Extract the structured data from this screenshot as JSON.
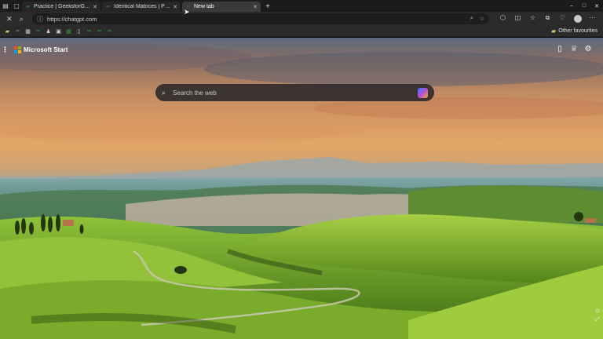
{
  "browser": {
    "tabs": [
      {
        "title": "Practice | GeeksforGee",
        "active": false
      },
      {
        "title": "Identical Matrices | Prac",
        "active": false
      },
      {
        "title": "New tab",
        "active": true
      }
    ],
    "new_tab_symbol": "+",
    "window_controls": [
      "–",
      "□",
      "✕"
    ],
    "address_bar": {
      "url": "https://chatgpt.com",
      "placeholder": ""
    },
    "favourites": {
      "other_label": "Other favourites"
    }
  },
  "page": {
    "brand": "Microsoft Start",
    "search": {
      "placeholder": "Search the web"
    }
  },
  "colors": {
    "accent": "#2f8d46",
    "tabstrip": "#1b1b1b",
    "toolbar": "#2b2b2b"
  }
}
